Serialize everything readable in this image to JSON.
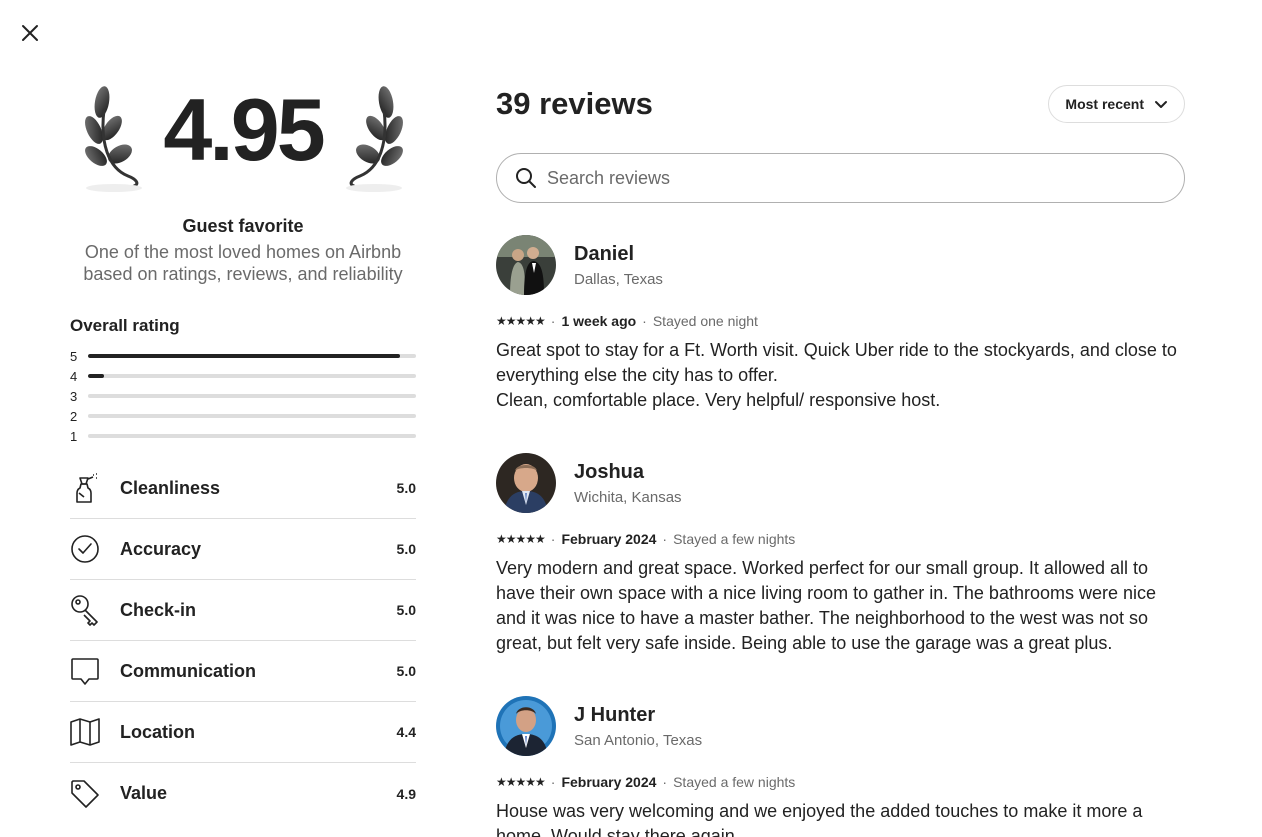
{
  "close_icon": "close-icon",
  "summary": {
    "score": "4.95",
    "title": "Guest favorite",
    "subtitle": "One of the most loved homes on Airbnb based on ratings, reviews, and reliability",
    "overall_title": "Overall rating",
    "distribution": [
      {
        "label": "5",
        "fraction": 0.95
      },
      {
        "label": "4",
        "fraction": 0.05
      },
      {
        "label": "3",
        "fraction": 0
      },
      {
        "label": "2",
        "fraction": 0
      },
      {
        "label": "1",
        "fraction": 0
      }
    ],
    "categories": [
      {
        "icon": "spray-bottle-icon",
        "label": "Cleanliness",
        "value": "5.0"
      },
      {
        "icon": "check-circle-icon",
        "label": "Accuracy",
        "value": "5.0"
      },
      {
        "icon": "key-icon",
        "label": "Check-in",
        "value": "5.0"
      },
      {
        "icon": "speech-bubble-icon",
        "label": "Communication",
        "value": "5.0"
      },
      {
        "icon": "map-icon",
        "label": "Location",
        "value": "4.4"
      },
      {
        "icon": "price-tag-icon",
        "label": "Value",
        "value": "4.9"
      }
    ]
  },
  "reviews_header": {
    "count_label": "39 reviews",
    "sort_label": "Most recent"
  },
  "search": {
    "placeholder": "Search reviews"
  },
  "reviews": [
    {
      "name": "Daniel",
      "location": "Dallas, Texas",
      "stars": "★★★★★",
      "date": "1 week ago",
      "stay": "Stayed one night",
      "text": "Great spot to stay for a Ft. Worth visit. Quick Uber ride to the stockyards, and close to everything else the city has to offer.\nClean, comfortable place. Very helpful/ responsive host."
    },
    {
      "name": "Joshua",
      "location": "Wichita, Kansas",
      "stars": "★★★★★",
      "date": "February 2024",
      "stay": "Stayed a few nights",
      "text": "Very modern and great space. Worked perfect for our small group. It allowed all to have their own space with a nice living room to gather in. The bathrooms were nice and it was nice to have a master bather. The neighborhood to the west was not so great, but felt very safe inside. Being able to use the garage was a great plus."
    },
    {
      "name": "J Hunter",
      "location": "San Antonio, Texas",
      "stars": "★★★★★",
      "date": "February 2024",
      "stay": "Stayed a few nights",
      "text": "House was very welcoming and we enjoyed the added touches to make it more a home. Would stay there again."
    }
  ]
}
